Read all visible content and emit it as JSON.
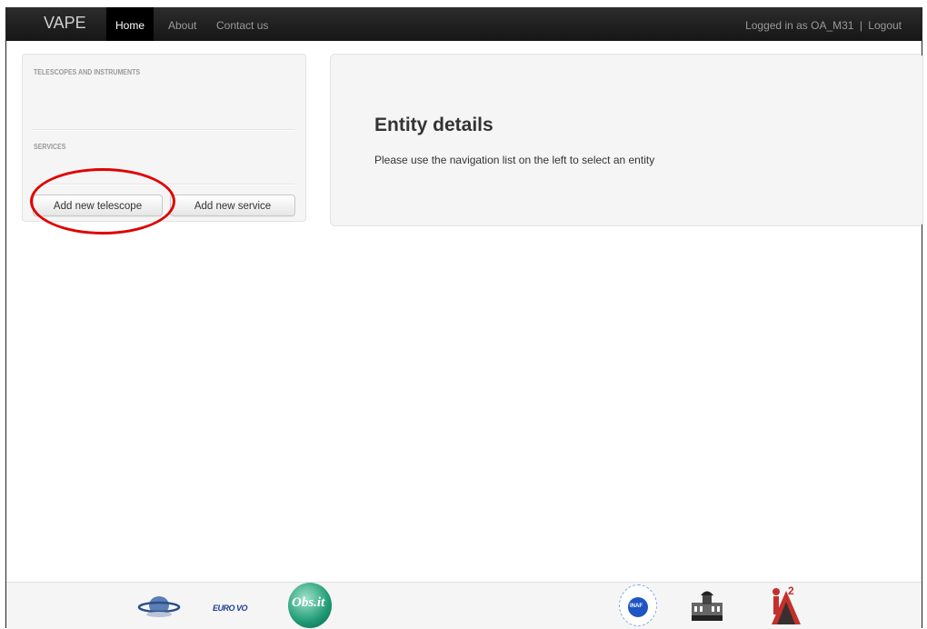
{
  "navbar": {
    "brand": "VAPE",
    "items": [
      {
        "label": "Home",
        "active": true
      },
      {
        "label": "About",
        "active": false
      },
      {
        "label": "Contact us",
        "active": false
      }
    ],
    "login_text": "Logged in as OA_M31",
    "separator": "|",
    "logout_label": "Logout"
  },
  "sidebar": {
    "sections": [
      {
        "header": "TELESCOPES AND INSTRUMENTS"
      },
      {
        "header": "SERVICES"
      }
    ],
    "buttons": {
      "add_telescope": "Add new telescope",
      "add_service": "Add new service"
    }
  },
  "main": {
    "title": "Entity details",
    "message": "Please use the navigation list on the left to select an entity"
  },
  "footer": {
    "logos": [
      {
        "icon": "planet-ring-logo"
      },
      {
        "icon": "euro-vo-logo",
        "text": "EURO VO"
      },
      {
        "icon": "vobs-logo",
        "text": "Obs.it"
      },
      {
        "icon": "inaf-logo",
        "text": "INAF"
      },
      {
        "icon": "observatory-building-logo"
      },
      {
        "icon": "ia2-logo",
        "text": "IA2"
      }
    ]
  },
  "colors": {
    "navbar_bg": "#1b1b1b",
    "panel_bg": "#f5f5f5",
    "highlight": "#e00000"
  }
}
